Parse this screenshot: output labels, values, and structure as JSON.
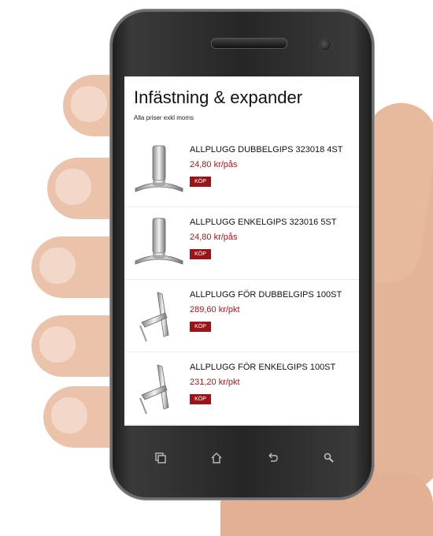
{
  "page": {
    "title": "Infästning & expander",
    "subtitle": "Alla priser exkl moms"
  },
  "products": [
    {
      "name": "ALLPLUGG DUBBELGIPS 323018 4ST",
      "price": "24,80 kr/pås",
      "buy_label": "KÖP",
      "image": "straight-plug"
    },
    {
      "name": "ALLPLUGG ENKELGIPS 323016 5ST",
      "price": "24,80 kr/pås",
      "buy_label": "KÖP",
      "image": "straight-plug"
    },
    {
      "name": "ALLPLUGG FÖR DUBBELGIPS 100ST",
      "price": "289,60 kr/pkt",
      "buy_label": "KÖP",
      "image": "angled-plug"
    },
    {
      "name": "ALLPLUGG FÖR ENKELGIPS 100ST",
      "price": "231,20 kr/pkt",
      "buy_label": "KÖP",
      "image": "angled-plug"
    }
  ],
  "nav": {
    "icons": [
      "recent-apps-icon",
      "home-icon",
      "back-icon",
      "search-icon"
    ]
  },
  "colors": {
    "price": "#a8171c",
    "buy_button": "#9e1318"
  }
}
